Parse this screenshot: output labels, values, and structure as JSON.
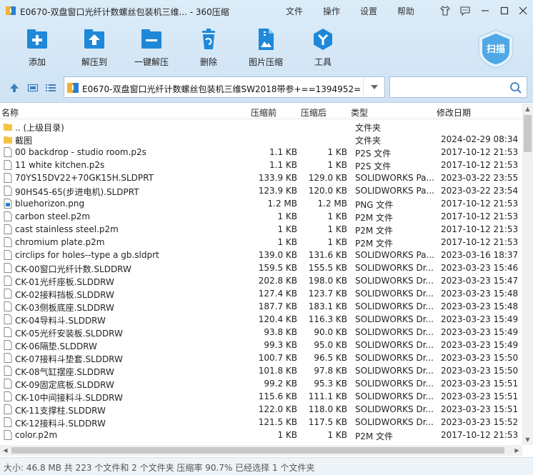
{
  "window": {
    "title": "E0670-双盘窗口光纤计数螺丝包装机三维... - 360压缩",
    "menus": [
      "文件",
      "操作",
      "设置",
      "帮助"
    ],
    "window_buttons": [
      "skin-icon",
      "feedback-icon",
      "minimize-icon",
      "maximize-icon",
      "close-icon"
    ]
  },
  "toolbar": {
    "buttons": [
      {
        "label": "添加",
        "icon": "add-icon"
      },
      {
        "label": "解压到",
        "icon": "extract-to-icon"
      },
      {
        "label": "一键解压",
        "icon": "one-click-extract-icon"
      },
      {
        "label": "删除",
        "icon": "delete-icon"
      },
      {
        "label": "图片压缩",
        "icon": "image-compress-icon"
      },
      {
        "label": "工具",
        "icon": "tools-icon"
      }
    ],
    "scan_label": "扫描"
  },
  "address": {
    "path": "E0670-双盘窗口光纤计数螺丝包装机三维SW2018带参+==1394952="
  },
  "search": {
    "placeholder": "",
    "value": ""
  },
  "columns": {
    "name": "名称",
    "size": "压缩前",
    "packed": "压缩后",
    "type": "类型",
    "date": "修改日期"
  },
  "files": [
    {
      "kind": "folder",
      "name": ".. (上级目录)",
      "size": "",
      "packed": "",
      "type": "文件夹",
      "date": ""
    },
    {
      "kind": "folder",
      "name": "截图",
      "size": "",
      "packed": "",
      "type": "文件夹",
      "date": "2024-02-29 08:34"
    },
    {
      "kind": "file",
      "name": "00 backdrop - studio room.p2s",
      "size": "1.1 KB",
      "packed": "1 KB",
      "type": "P2S 文件",
      "date": "2017-10-12 21:53"
    },
    {
      "kind": "file",
      "name": "11 white kitchen.p2s",
      "size": "1.1 KB",
      "packed": "1 KB",
      "type": "P2S 文件",
      "date": "2017-10-12 21:53"
    },
    {
      "kind": "file",
      "name": "70YS15DV22+70GK15H.SLDPRT",
      "size": "133.9 KB",
      "packed": "129.0 KB",
      "type": "SOLIDWORKS Pa...",
      "date": "2023-03-22 23:55"
    },
    {
      "kind": "file",
      "name": "90HS45-65(步进电机).SLDPRT",
      "size": "123.9 KB",
      "packed": "120.0 KB",
      "type": "SOLIDWORKS Pa...",
      "date": "2023-03-22 23:54"
    },
    {
      "kind": "image",
      "name": "bluehorizon.png",
      "size": "1.2 MB",
      "packed": "1.2 MB",
      "type": "PNG 文件",
      "date": "2017-10-12 21:53"
    },
    {
      "kind": "file",
      "name": "carbon steel.p2m",
      "size": "1 KB",
      "packed": "1 KB",
      "type": "P2M 文件",
      "date": "2017-10-12 21:53"
    },
    {
      "kind": "file",
      "name": "cast stainless steel.p2m",
      "size": "1 KB",
      "packed": "1 KB",
      "type": "P2M 文件",
      "date": "2017-10-12 21:53"
    },
    {
      "kind": "file",
      "name": "chromium plate.p2m",
      "size": "1 KB",
      "packed": "1 KB",
      "type": "P2M 文件",
      "date": "2017-10-12 21:53"
    },
    {
      "kind": "file",
      "name": "circlips for holes--type a gb.sldprt",
      "size": "139.0 KB",
      "packed": "131.6 KB",
      "type": "SOLIDWORKS Pa...",
      "date": "2023-03-16 18:37"
    },
    {
      "kind": "file",
      "name": "CK-00窗口光纤计数.SLDDRW",
      "size": "159.5 KB",
      "packed": "155.5 KB",
      "type": "SOLIDWORKS Dr...",
      "date": "2023-03-23 15:46"
    },
    {
      "kind": "file",
      "name": "CK-01光纤座板.SLDDRW",
      "size": "202.8 KB",
      "packed": "198.0 KB",
      "type": "SOLIDWORKS Dr...",
      "date": "2023-03-23 15:47"
    },
    {
      "kind": "file",
      "name": "CK-02接料挡板.SLDDRW",
      "size": "127.4 KB",
      "packed": "123.7 KB",
      "type": "SOLIDWORKS Dr...",
      "date": "2023-03-23 15:48"
    },
    {
      "kind": "file",
      "name": "CK-03侧板底座.SLDDRW",
      "size": "187.7 KB",
      "packed": "183.1 KB",
      "type": "SOLIDWORKS Dr...",
      "date": "2023-03-23 15:48"
    },
    {
      "kind": "file",
      "name": "CK-04导料斗.SLDDRW",
      "size": "120.4 KB",
      "packed": "116.3 KB",
      "type": "SOLIDWORKS Dr...",
      "date": "2023-03-23 15:49"
    },
    {
      "kind": "file",
      "name": "CK-05光纤安装板.SLDDRW",
      "size": "93.8 KB",
      "packed": "90.0 KB",
      "type": "SOLIDWORKS Dr...",
      "date": "2023-03-23 15:49"
    },
    {
      "kind": "file",
      "name": "CK-06隔垫.SLDDRW",
      "size": "99.3 KB",
      "packed": "95.0 KB",
      "type": "SOLIDWORKS Dr...",
      "date": "2023-03-23 15:49"
    },
    {
      "kind": "file",
      "name": "CK-07接料斗垫套.SLDDRW",
      "size": "100.7 KB",
      "packed": "96.5 KB",
      "type": "SOLIDWORKS Dr...",
      "date": "2023-03-23 15:50"
    },
    {
      "kind": "file",
      "name": "CK-08气缸摆座.SLDDRW",
      "size": "101.8 KB",
      "packed": "97.8 KB",
      "type": "SOLIDWORKS Dr...",
      "date": "2023-03-23 15:50"
    },
    {
      "kind": "file",
      "name": "CK-09固定底板.SLDDRW",
      "size": "99.2 KB",
      "packed": "95.3 KB",
      "type": "SOLIDWORKS Dr...",
      "date": "2023-03-23 15:51"
    },
    {
      "kind": "file",
      "name": "CK-10中间接料斗.SLDDRW",
      "size": "115.6 KB",
      "packed": "111.1 KB",
      "type": "SOLIDWORKS Dr...",
      "date": "2023-03-23 15:51"
    },
    {
      "kind": "file",
      "name": "CK-11支撑柱.SLDDRW",
      "size": "122.0 KB",
      "packed": "118.0 KB",
      "type": "SOLIDWORKS Dr...",
      "date": "2023-03-23 15:51"
    },
    {
      "kind": "file",
      "name": "CK-12接料斗.SLDDRW",
      "size": "121.5 KB",
      "packed": "117.5 KB",
      "type": "SOLIDWORKS Dr...",
      "date": "2023-03-23 15:52"
    },
    {
      "kind": "file",
      "name": "color.p2m",
      "size": "1 KB",
      "packed": "1 KB",
      "type": "P2M 文件",
      "date": "2017-10-12 21:53"
    }
  ],
  "status": "大小: 46.8 MB 共 223 个文件和 2 个文件夹 压缩率 90.7% 已经选择 1 个文件夹",
  "colors": {
    "accent": "#1e88d9",
    "folder": "#f5c343",
    "toolbar_bg": "#d6e8f7"
  }
}
